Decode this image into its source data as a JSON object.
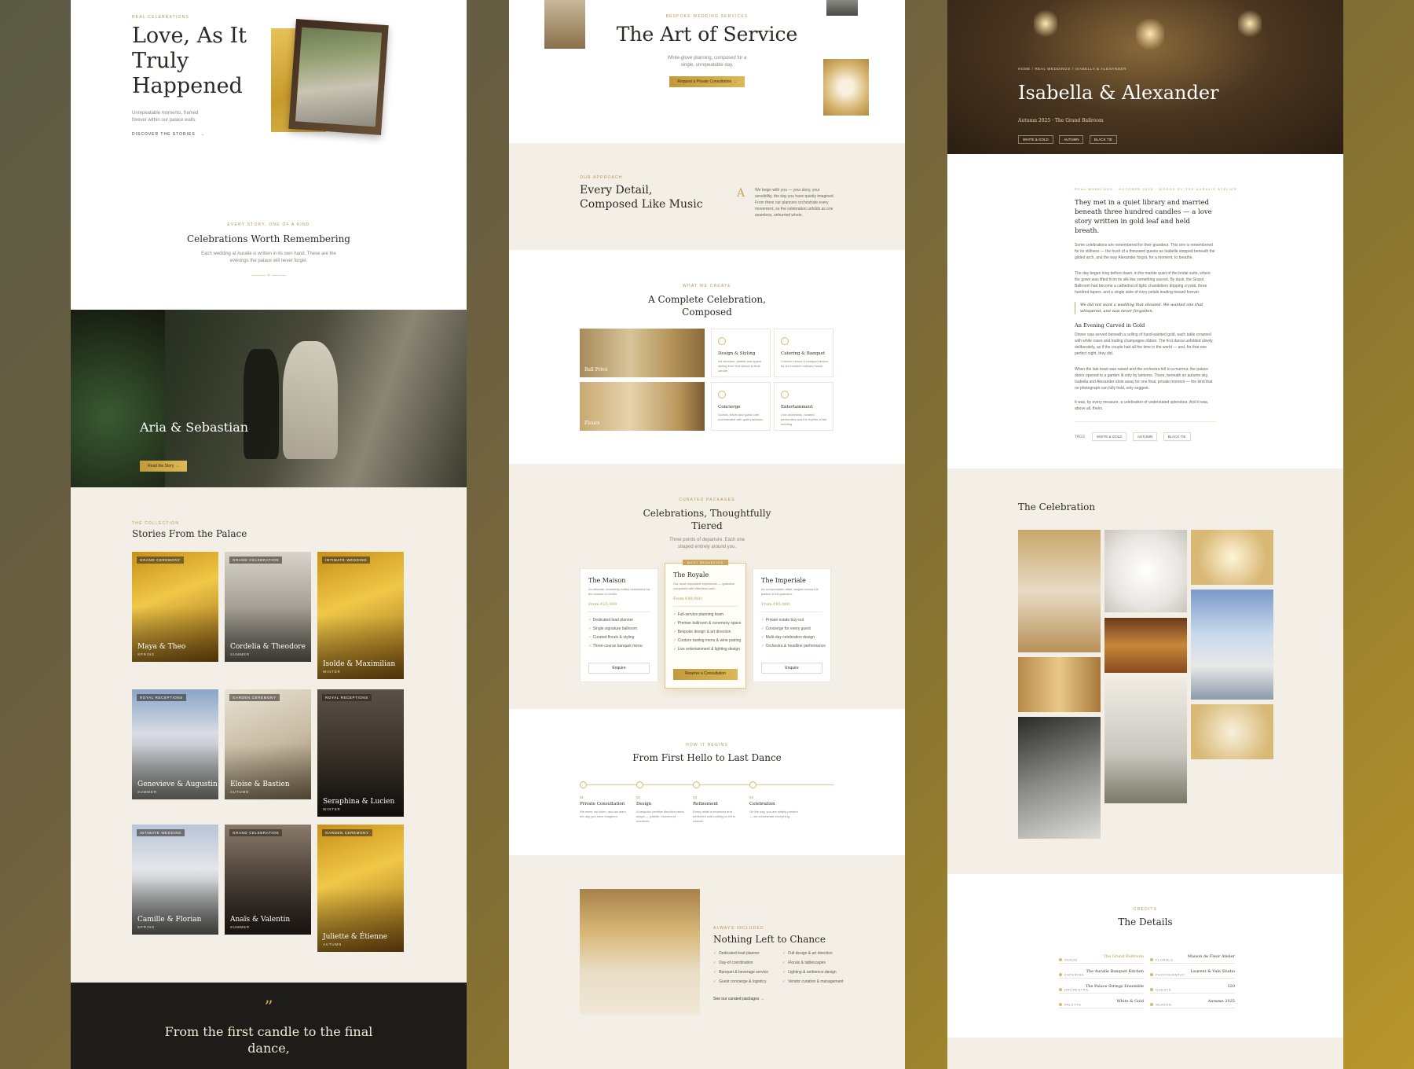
{
  "panel1": {
    "hero": {
      "eyebrow": "REAL CELEBRATIONS",
      "title_line1": "Love, As It",
      "title_line2": "Truly",
      "title_line3": "Happened",
      "subtitle": "Unrepeatable moments, framed forever within our palace walls.",
      "cta": "DISCOVER THE STORIES"
    },
    "intro": {
      "eyebrow": "EVERY STORY, ONE OF A KIND",
      "title": "Celebrations Worth Remembering",
      "text": "Each wedding at Auralie is written in its own hand. These are the evenings the palace will never forget."
    },
    "featured": {
      "title": "Aria & Sebastian",
      "cta": "Read the Story"
    },
    "collection": {
      "eyebrow": "THE COLLECTION",
      "title": "Stories From the Palace",
      "cards": [
        {
          "chip": "GRAND CEREMONY",
          "title": "Maya & Theo",
          "sub": "SPRING"
        },
        {
          "chip": "GRAND CELEBRATION",
          "title": "Cordelia & Theodore",
          "sub": "SUMMER"
        },
        {
          "chip": "INTIMATE WEDDING",
          "title": "Isolde & Maximilian",
          "sub": "WINTER"
        },
        {
          "chip": "ROYAL RECEPTIONS",
          "title": "Genevieve & Augustin",
          "sub": "SUMMER"
        },
        {
          "chip": "GARDEN CEREMONY",
          "title": "Eloise & Bastien",
          "sub": "AUTUMN"
        },
        {
          "chip": "ROYAL RECEPTIONS",
          "title": "Seraphina & Lucien",
          "sub": "WINTER"
        },
        {
          "chip": "INTIMATE WEDDING",
          "title": "Camille & Florian",
          "sub": "SPRING"
        },
        {
          "chip": "GRAND CELEBRATION",
          "title": "Anaïs & Valentin",
          "sub": "SUMMER"
        },
        {
          "chip": "GARDEN CEREMONY",
          "title": "Juliette & Étienne",
          "sub": "AUTUMN"
        }
      ]
    },
    "quote": {
      "mark": "”",
      "line1": "From the first candle to the final",
      "line2": "dance,"
    }
  },
  "panel2": {
    "hero": {
      "eyebrow": "BESPOKE WEDDING SERVICES",
      "title": "The Art of Service",
      "subtitle": "White-glove planning, composed for a single, unrepeatable day.",
      "cta": "Request a Private Consultation"
    },
    "approach": {
      "eyebrow": "OUR APPROACH",
      "title_line1": "Every Detail,",
      "title_line2": "Composed Like Music",
      "monogram": "A",
      "text": "We begin with you — your story, your sensibility, the day you have quietly imagined. From there our planners orchestrate every movement, so the celebration unfolds as one seamless, unhurried whole."
    },
    "create": {
      "eyebrow": "WHAT WE CREATE",
      "title_line1": "A Complete Celebration,",
      "title_line2": "Composed",
      "images": [
        "Ball Privé",
        "Fleurs"
      ],
      "features": [
        {
          "title": "Design & Styling",
          "text": "Art direction, palette and space styling from first sketch to final candle."
        },
        {
          "title": "Catering & Banquet",
          "text": "Couture menus & banquet service by our resident culinary house."
        },
        {
          "title": "Concierge",
          "text": "Guests, travel and guest care, orchestrated with quiet precision."
        },
        {
          "title": "Entertainment",
          "text": "Live orchestras, curated performers and the rhythm of the evening."
        }
      ]
    },
    "packages": {
      "eyebrow": "CURATED PACKAGES",
      "title_line1": "Celebrations, Thoughtfully",
      "title_line2": "Tiered",
      "subtitle": "Three points of departure. Each one shaped entirely around you.",
      "badge": "MOST REQUESTED",
      "tiers": [
        {
          "name": "The Maison",
          "desc": "An intimate, beautifully edited celebration for the closest of circles.",
          "price": "From €25,000",
          "items": [
            "Dedicated lead planner",
            "Single signature ballroom",
            "Curated florals & styling",
            "Three-course banquet menu"
          ],
          "cta": "Enquire"
        },
        {
          "name": "The Royale",
          "desc": "Our most requested experience — grandeur composed with effortless calm.",
          "price": "From €48,000",
          "items": [
            "Full-service planning team",
            "Premier ballroom & ceremony space",
            "Bespoke design & art direction",
            "Couture tasting menu & wine pairing",
            "Live entertainment & lighting design"
          ],
          "cta": "Reserve a Consultation"
        },
        {
          "name": "The Imperiale",
          "desc": "An unrepeatable affair, staged across the palace in full grandeur.",
          "price": "From €95,000",
          "items": [
            "Private estate buy-out",
            "Concierge for every guest",
            "Multi-day celebration design",
            "Orchestra & headline performance"
          ],
          "cta": "Enquire"
        }
      ]
    },
    "process": {
      "eyebrow": "HOW IT BEGINS",
      "title": "From First Hello to Last Dance",
      "steps": [
        {
          "num": "01",
          "title": "Private Consultation",
          "text": "We meet, we listen, and we learn the day you have imagined."
        },
        {
          "num": "02",
          "title": "Design",
          "text": "A bespoke creative direction takes shape — palette, movement, moments."
        },
        {
          "num": "03",
          "title": "Refinement",
          "text": "Every detail is reviewed and perfected until nothing is left to chance."
        },
        {
          "num": "04",
          "title": "Celebration",
          "text": "On the day, you are simply present — we orchestrate everything."
        }
      ]
    },
    "included": {
      "eyebrow": "ALWAYS INCLUDED",
      "title": "Nothing Left to Chance",
      "col1": [
        "Dedicated lead planner",
        "Day-of coordination",
        "Banquet & beverage service",
        "Guest concierge & logistics"
      ],
      "col2": [
        "Full design & art direction",
        "Florals & tablescapes",
        "Lighting & ambience design",
        "Vendor curation & management"
      ],
      "link": "See our curated packages"
    }
  },
  "panel3": {
    "hero": {
      "breadcrumb": "HOME / REAL WEDDINGS / ISABELLA & ALEXANDER",
      "title": "Isabella & Alexander",
      "meta": "Autumn 2025 · The Grand Ballroom",
      "tags": [
        "WHITE & GOLD",
        "AUTUMN",
        "BLACK TIE"
      ]
    },
    "story": {
      "meta": "REAL WEDDINGS · OCTOBER 2025 · WORDS BY THE AURALIE ATELIER",
      "lead": "They met in a quiet library and married beneath three hundred candles — a love story written in gold leaf and held breath.",
      "p1": "Some celebrations are remembered for their grandeur. This one is remembered for its stillness — the hush of a thousand guests as Isabella stepped beneath the gilded arch, and the way Alexander forgot, for a moment, to breathe.",
      "p2": "The day began long before dawn, in the marble quiet of the bridal suite, where the gown was lifted from its silk like something sacred. By dusk, the Grand Ballroom had become a cathedral of light: chandeliers dripping crystal, three hundred tapers, and a single aisle of ivory petals leading toward forever.",
      "quote": "We did not want a wedding that shouted. We wanted one that whispered, and was never forgotten.",
      "subheading": "An Evening Carved in Gold",
      "p3": "Dinner was served beneath a ceiling of hand-painted gold, each table crowned with white roses and trailing champagne ribbon. The first dance unfolded slowly, deliberately, as if the couple had all the time in the world — and, for that one perfect night, they did.",
      "p4": "When the last toast was raised and the orchestra fell to a murmur, the palace doors opened to a garden lit only by lanterns. There, beneath an autumn sky, Isabella and Alexander stole away for one final, private moment — the kind that no photograph can fully hold, only suggest.",
      "p5": "It was, by every measure, a celebration of understated splendour. And it was, above all, theirs.",
      "tags_label": "TAGS",
      "tags": [
        "WHITE & GOLD",
        "AUTUMN",
        "BLACK TIE"
      ]
    },
    "gallery": {
      "title": "The Celebration"
    },
    "details": {
      "eyebrow": "CREDITS",
      "title": "The Details",
      "rows": [
        {
          "label": "VENUE",
          "value": "The Grand Ballroom"
        },
        {
          "label": "CATERING",
          "value": "The Auralie Banquet Kitchen"
        },
        {
          "label": "ORCHESTRA",
          "value": "The Palace Strings Ensemble"
        },
        {
          "label": "PALETTE",
          "value": "White & Gold"
        },
        {
          "label": "FLORALS",
          "value": "Maison de Fleur Atelier"
        },
        {
          "label": "PHOTOGRAPHY",
          "value": "Laurent & Vale Studio"
        },
        {
          "label": "GUESTS",
          "value": "320"
        },
        {
          "label": "SEASON",
          "value": "Autumn 2025"
        }
      ]
    }
  },
  "colors": {
    "accent_gold": "#b8954a",
    "cream": "#f3efe6",
    "dark": "#1e1c19"
  }
}
